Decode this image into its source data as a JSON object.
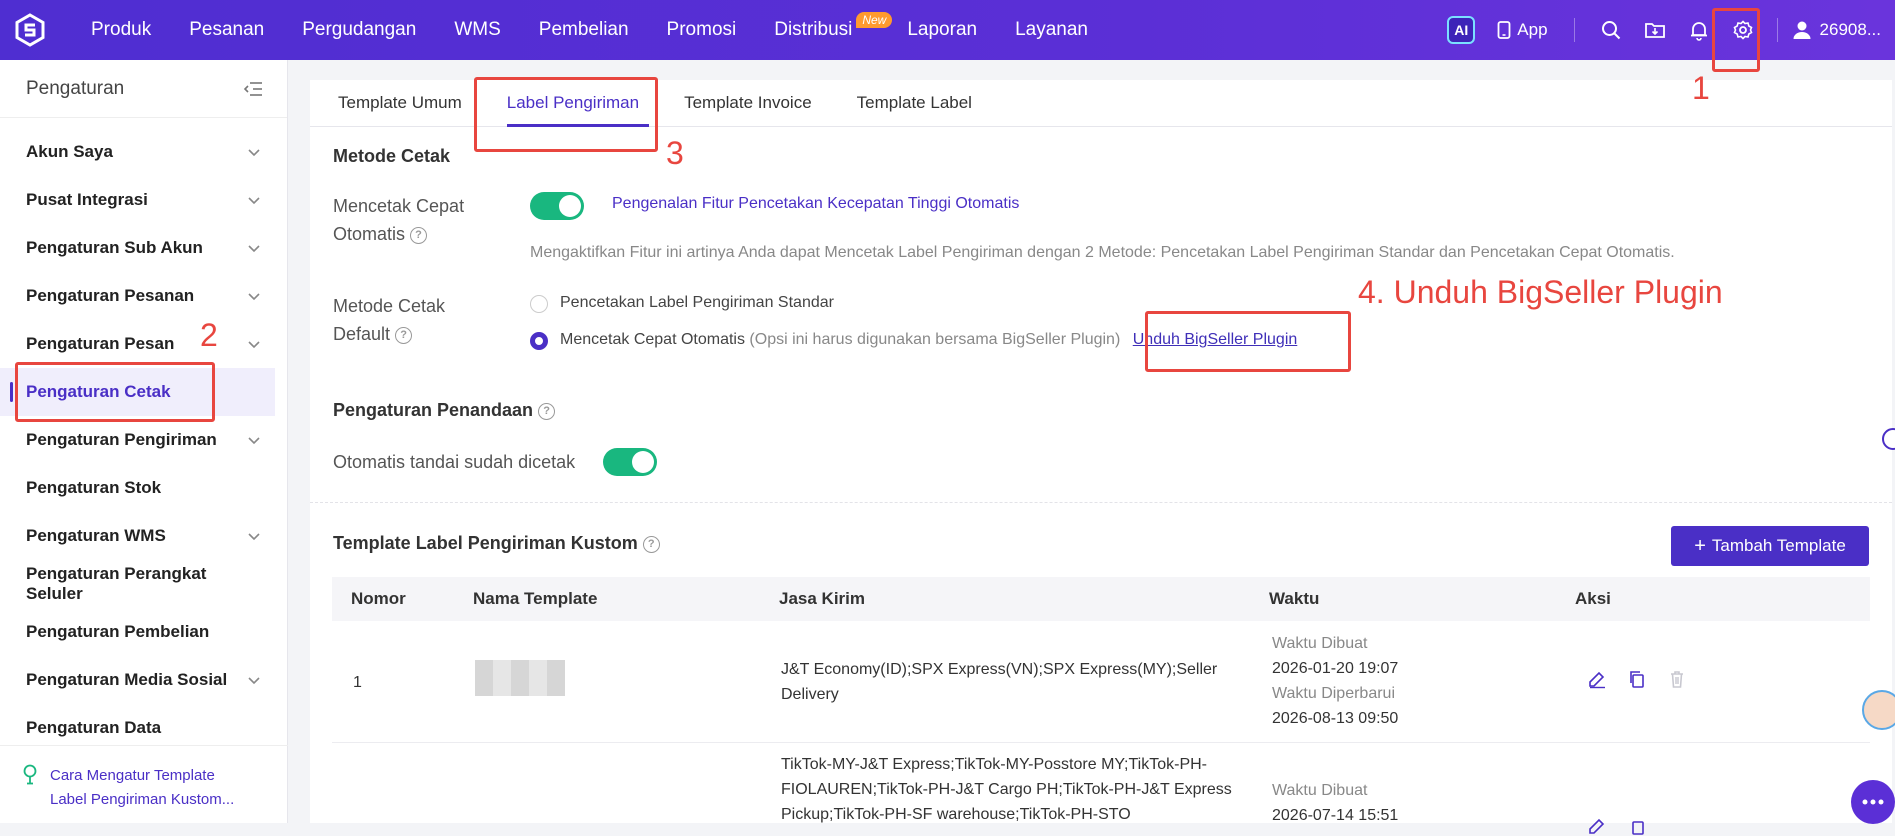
{
  "topbar": {
    "nav": [
      "Produk",
      "Pesanan",
      "Pergudangan",
      "WMS",
      "Pembelian",
      "Promosi",
      "Distribusi",
      "Laporan",
      "Layanan"
    ],
    "new_badge": "New",
    "ai_label": "AI",
    "app_label": "App",
    "user_label": "26908..."
  },
  "sidebar": {
    "title": "Pengaturan",
    "items": [
      {
        "label": "Akun Saya",
        "chevron": true
      },
      {
        "label": "Pusat Integrasi",
        "chevron": true
      },
      {
        "label": "Pengaturan Sub Akun",
        "chevron": true
      },
      {
        "label": "Pengaturan Pesanan",
        "chevron": true
      },
      {
        "label": "Pengaturan Pesan",
        "chevron": true
      },
      {
        "label": "Pengaturan Cetak",
        "chevron": false,
        "active": true
      },
      {
        "label": "Pengaturan Pengiriman",
        "chevron": true
      },
      {
        "label": "Pengaturan Stok",
        "chevron": false
      },
      {
        "label": "Pengaturan WMS",
        "chevron": true
      },
      {
        "label": "Pengaturan Perangkat Seluler",
        "chevron": false
      },
      {
        "label": "Pengaturan Pembelian",
        "chevron": false
      },
      {
        "label": "Pengaturan Media Sosial",
        "chevron": true
      },
      {
        "label": "Pengaturan Data",
        "chevron": false
      }
    ],
    "help_line1": "Cara Mengatur Template",
    "help_line2": "Label Pengiriman Kustom..."
  },
  "tabs": [
    "Template Umum",
    "Label Pengiriman",
    "Template Invoice",
    "Template Label"
  ],
  "print_method": {
    "section_title": "Metode Cetak",
    "fast_label_1": "Mencetak Cepat",
    "fast_label_2": "Otomatis",
    "intro_link": "Pengenalan Fitur Pencetakan Kecepatan Tinggi Otomatis",
    "desc": "Mengaktifkan Fitur ini artinya Anda dapat Mencetak Label Pengiriman dengan 2 Metode: Pencetakan Label Pengiriman Standar dan Pencetakan Cepat Otomatis.",
    "default_label_1": "Metode Cetak",
    "default_label_2": "Default",
    "option_standard": "Pencetakan Label Pengiriman Standar",
    "option_fast": "Mencetak Cepat Otomatis",
    "option_fast_note": "(Opsi ini harus digunakan bersama BigSeller Plugin)",
    "plugin_link": "Unduh BigSeller Plugin"
  },
  "marking": {
    "section_title": "Pengaturan Penandaan",
    "auto_mark_label": "Otomatis tandai sudah dicetak"
  },
  "custom_templates": {
    "section_title": "Template Label Pengiriman Kustom",
    "add_button": "Tambah Template",
    "columns": [
      "Nomor",
      "Nama Template",
      "Jasa Kirim",
      "Waktu",
      "Aksi"
    ],
    "rows": [
      {
        "no": "1",
        "jasa_1": "J&T Economy(ID);SPX Express(VN);SPX Express(MY);Seller",
        "jasa_2": "Delivery",
        "created_label": "Waktu Dibuat",
        "created": "2026-01-20 19:07",
        "updated_label": "Waktu Diperbarui",
        "updated": "2026-08-13 09:50"
      },
      {
        "no": "",
        "jasa_1": "TikTok-MY-J&T Express;TikTok-MY-Posstore MY;TikTok-PH-",
        "jasa_2": "FIOLAUREN;TikTok-PH-J&T Cargo PH;TikTok-PH-J&T Express",
        "jasa_3": "Pickup;TikTok-PH-SF warehouse;TikTok-PH-STO",
        "created_label": "Waktu Dibuat",
        "created": "2026-07-14 15:51"
      }
    ]
  },
  "annotations": {
    "n1": "1",
    "n2": "2",
    "n3": "3",
    "n4": "4. Unduh BigSeller Plugin",
    "color": "#e8463f"
  },
  "colors": {
    "brand": "#4a2fc6",
    "toggle_on": "#19b77f"
  }
}
